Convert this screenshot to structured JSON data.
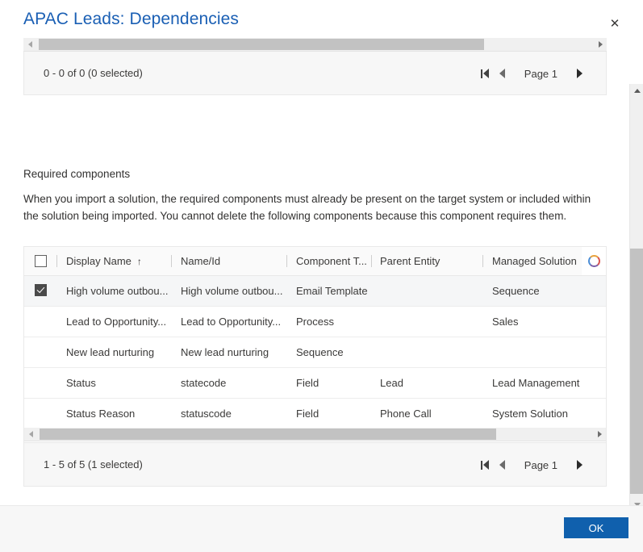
{
  "dialog": {
    "title": "APAC Leads: Dependencies",
    "close_label": "✕"
  },
  "top_grid": {
    "count_label": "0 - 0 of 0 (0 selected)",
    "page_label": "Page 1"
  },
  "required_components": {
    "heading": "Required components",
    "description": "When you import a solution, the required components must already be present on the target system or included within the solution being imported. You cannot delete the following components because this component requires them."
  },
  "grid": {
    "columns": [
      {
        "label": "Display Name",
        "sort": "↑"
      },
      {
        "label": "Name/Id",
        "sort": ""
      },
      {
        "label": "Component T...",
        "sort": ""
      },
      {
        "label": "Parent Entity",
        "sort": ""
      },
      {
        "label": "Managed Solution",
        "sort": ""
      }
    ],
    "rows": [
      {
        "selected": true,
        "display_name": "High volume outbou...",
        "name_id": "High volume outbou...",
        "component_type": "Email Template",
        "parent_entity": "",
        "managed_solution": "Sequence"
      },
      {
        "selected": false,
        "display_name": "Lead to Opportunity...",
        "name_id": "Lead to Opportunity...",
        "component_type": "Process",
        "parent_entity": "",
        "managed_solution": "Sales"
      },
      {
        "selected": false,
        "display_name": "New lead nurturing",
        "name_id": "New lead nurturing",
        "component_type": "Sequence",
        "parent_entity": "",
        "managed_solution": ""
      },
      {
        "selected": false,
        "display_name": "Status",
        "name_id": "statecode",
        "component_type": "Field",
        "parent_entity": "Lead",
        "managed_solution": "Lead Management"
      },
      {
        "selected": false,
        "display_name": "Status Reason",
        "name_id": "statuscode",
        "component_type": "Field",
        "parent_entity": "Phone Call",
        "managed_solution": "System Solution"
      }
    ],
    "count_label": "1 - 5 of 5 (1 selected)",
    "page_label": "Page 1"
  },
  "footer": {
    "ok_label": "OK"
  },
  "colors": {
    "title": "#1a5fb4",
    "primary_button": "#1060ad",
    "selected_row": "#f5f6f7",
    "scrollbar_thumb": "#c2c2c2"
  }
}
